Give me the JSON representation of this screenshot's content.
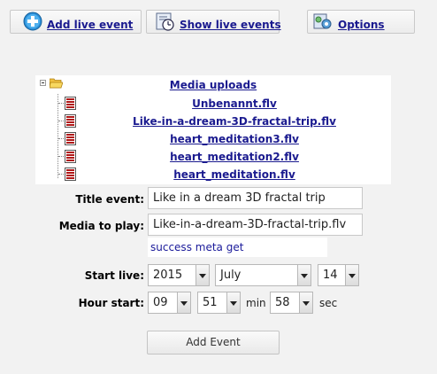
{
  "toolbar": {
    "add_live_event": "Add live event",
    "show_live_events": "Show live events",
    "options": "Options",
    "icons": [
      "plus-circle-icon",
      "clock-list-icon",
      "gear-options-icon"
    ]
  },
  "tree": {
    "root_label": "Media uploads",
    "files": [
      "Unbenannt.flv",
      "Like-in-a-dream-3D-fractal-trip.flv",
      "heart_meditation3.flv",
      "heart_meditation2.flv",
      "heart_meditation.flv"
    ]
  },
  "form": {
    "title_label": "Title event:",
    "title_value": "Like in a dream 3D fractal trip",
    "media_label": "Media to play:",
    "media_value": "Like-in-a-dream-3D-fractal-trip.flv",
    "status_text": "success meta get",
    "start_live_label": "Start live:",
    "year": "2015",
    "month": "July",
    "day": "14",
    "hour_start_label": "Hour start:",
    "hour": "09",
    "minute": "51",
    "min_unit": "min",
    "second": "58",
    "sec_unit": "sec",
    "submit_label": "Add Event"
  },
  "colors": {
    "link": "#1a1a8f",
    "background": "#f2f2f2",
    "file_icon_red": "#b01818"
  }
}
